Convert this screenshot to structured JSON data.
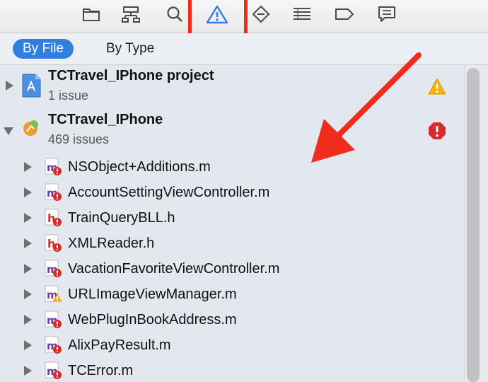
{
  "toolbar": {
    "icons": [
      "folder-icon",
      "hierarchy-icon",
      "search-icon",
      "warning-icon",
      "breakpoint-icon",
      "list-icon",
      "tag-icon",
      "chat-icon"
    ],
    "selected": "warning-icon",
    "accent": "#2f7fe0",
    "annotation_color": "#f02d1c"
  },
  "scope": {
    "by_file": "By File",
    "by_type": "By Type"
  },
  "projects": [
    {
      "title": "TCTravel_IPhone project",
      "subtitle": "1 issue",
      "status": "warning"
    },
    {
      "title": "TCTravel_IPhone",
      "subtitle": "469 issues",
      "status": "error"
    }
  ],
  "files": [
    {
      "name": "NSObject+Additions.m",
      "type": "m",
      "badge": "error"
    },
    {
      "name": "AccountSettingViewController.m",
      "type": "m",
      "badge": "error"
    },
    {
      "name": "TrainQueryBLL.h",
      "type": "h",
      "badge": "error"
    },
    {
      "name": "XMLReader.h",
      "type": "h",
      "badge": "error"
    },
    {
      "name": "VacationFavoriteViewController.m",
      "type": "m",
      "badge": "error"
    },
    {
      "name": "URLImageViewManager.m",
      "type": "m",
      "badge": "warning"
    },
    {
      "name": "WebPlugInBookAddress.m",
      "type": "m",
      "badge": "error"
    },
    {
      "name": "AlixPayResult.m",
      "type": "m",
      "badge": "error"
    },
    {
      "name": "TCError.m",
      "type": "m",
      "badge": "error"
    }
  ]
}
